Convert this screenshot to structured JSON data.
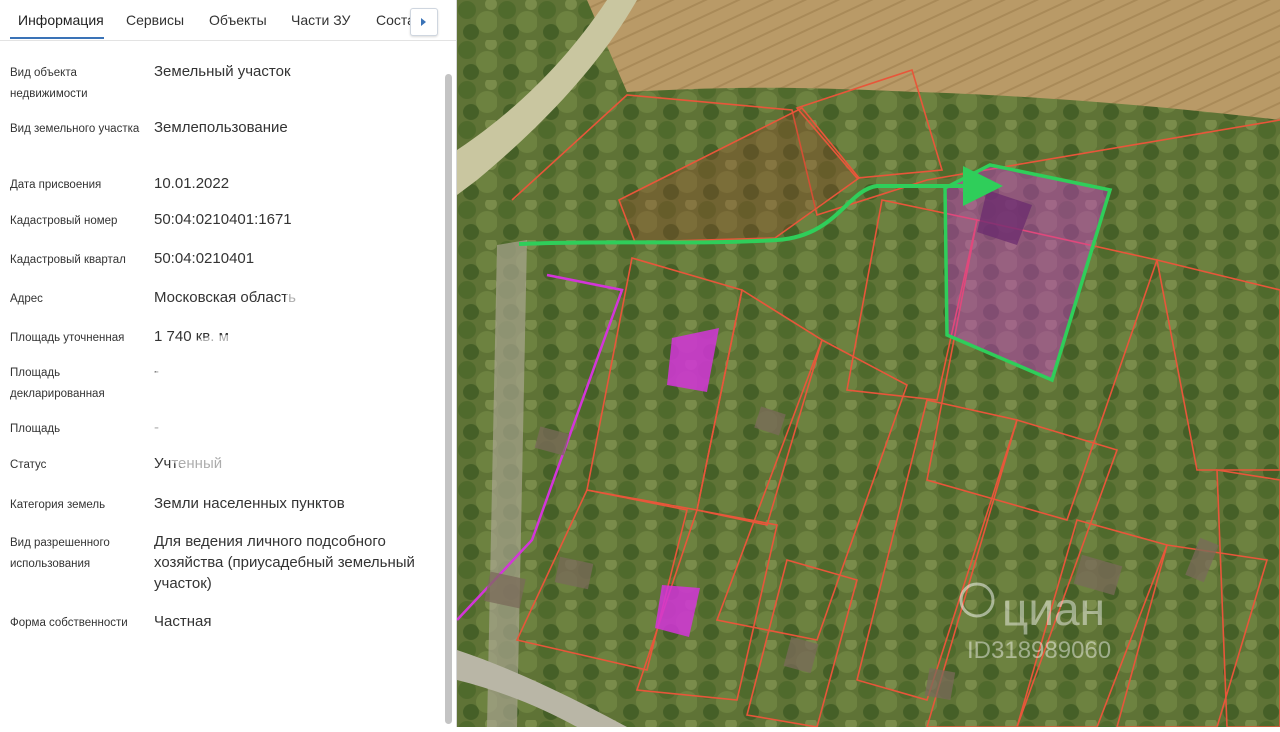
{
  "tabs": [
    "Информация",
    "Сервисы",
    "Объекты",
    "Части ЗУ",
    "Соста"
  ],
  "fields": [
    {
      "label": "Вид объекта недвижимости",
      "value": "Земельный участок"
    },
    {
      "label": "Вид земельного участка",
      "value": "Землепользование"
    },
    {
      "label": "Дата присвоения",
      "value": "10.01.2022"
    },
    {
      "label": "Кадастровый номер",
      "value": "50:04:0210401:1671"
    },
    {
      "label": "Кадастровый квартал",
      "value": "50:04:0210401"
    },
    {
      "label": "Адрес",
      "value": "Московская область"
    },
    {
      "label": "Площадь уточненная",
      "value": "1 740 кв. м"
    },
    {
      "label": "Площадь декларированная",
      "value": "-"
    },
    {
      "label": "Площадь",
      "value": "-"
    },
    {
      "label": "Статус",
      "value": "Учтенный"
    },
    {
      "label": "Категория земель",
      "value": "Земли населенных пунктов"
    },
    {
      "label": "Вид разрешенного использования",
      "value": "Для ведения личного подсобного хозяйства (приусадебный земельный участок)"
    },
    {
      "label": "Форма собственности",
      "value": "Частная"
    }
  ],
  "watermark": {
    "brand": "циан",
    "id": "ID318989060"
  },
  "colors": {
    "accent": "#3a73b7",
    "parcel_border": "#e8563a",
    "selected_parcel": "#2fce5a",
    "highlight_fill": "#d335d9",
    "arrow": "#2fce5a"
  }
}
